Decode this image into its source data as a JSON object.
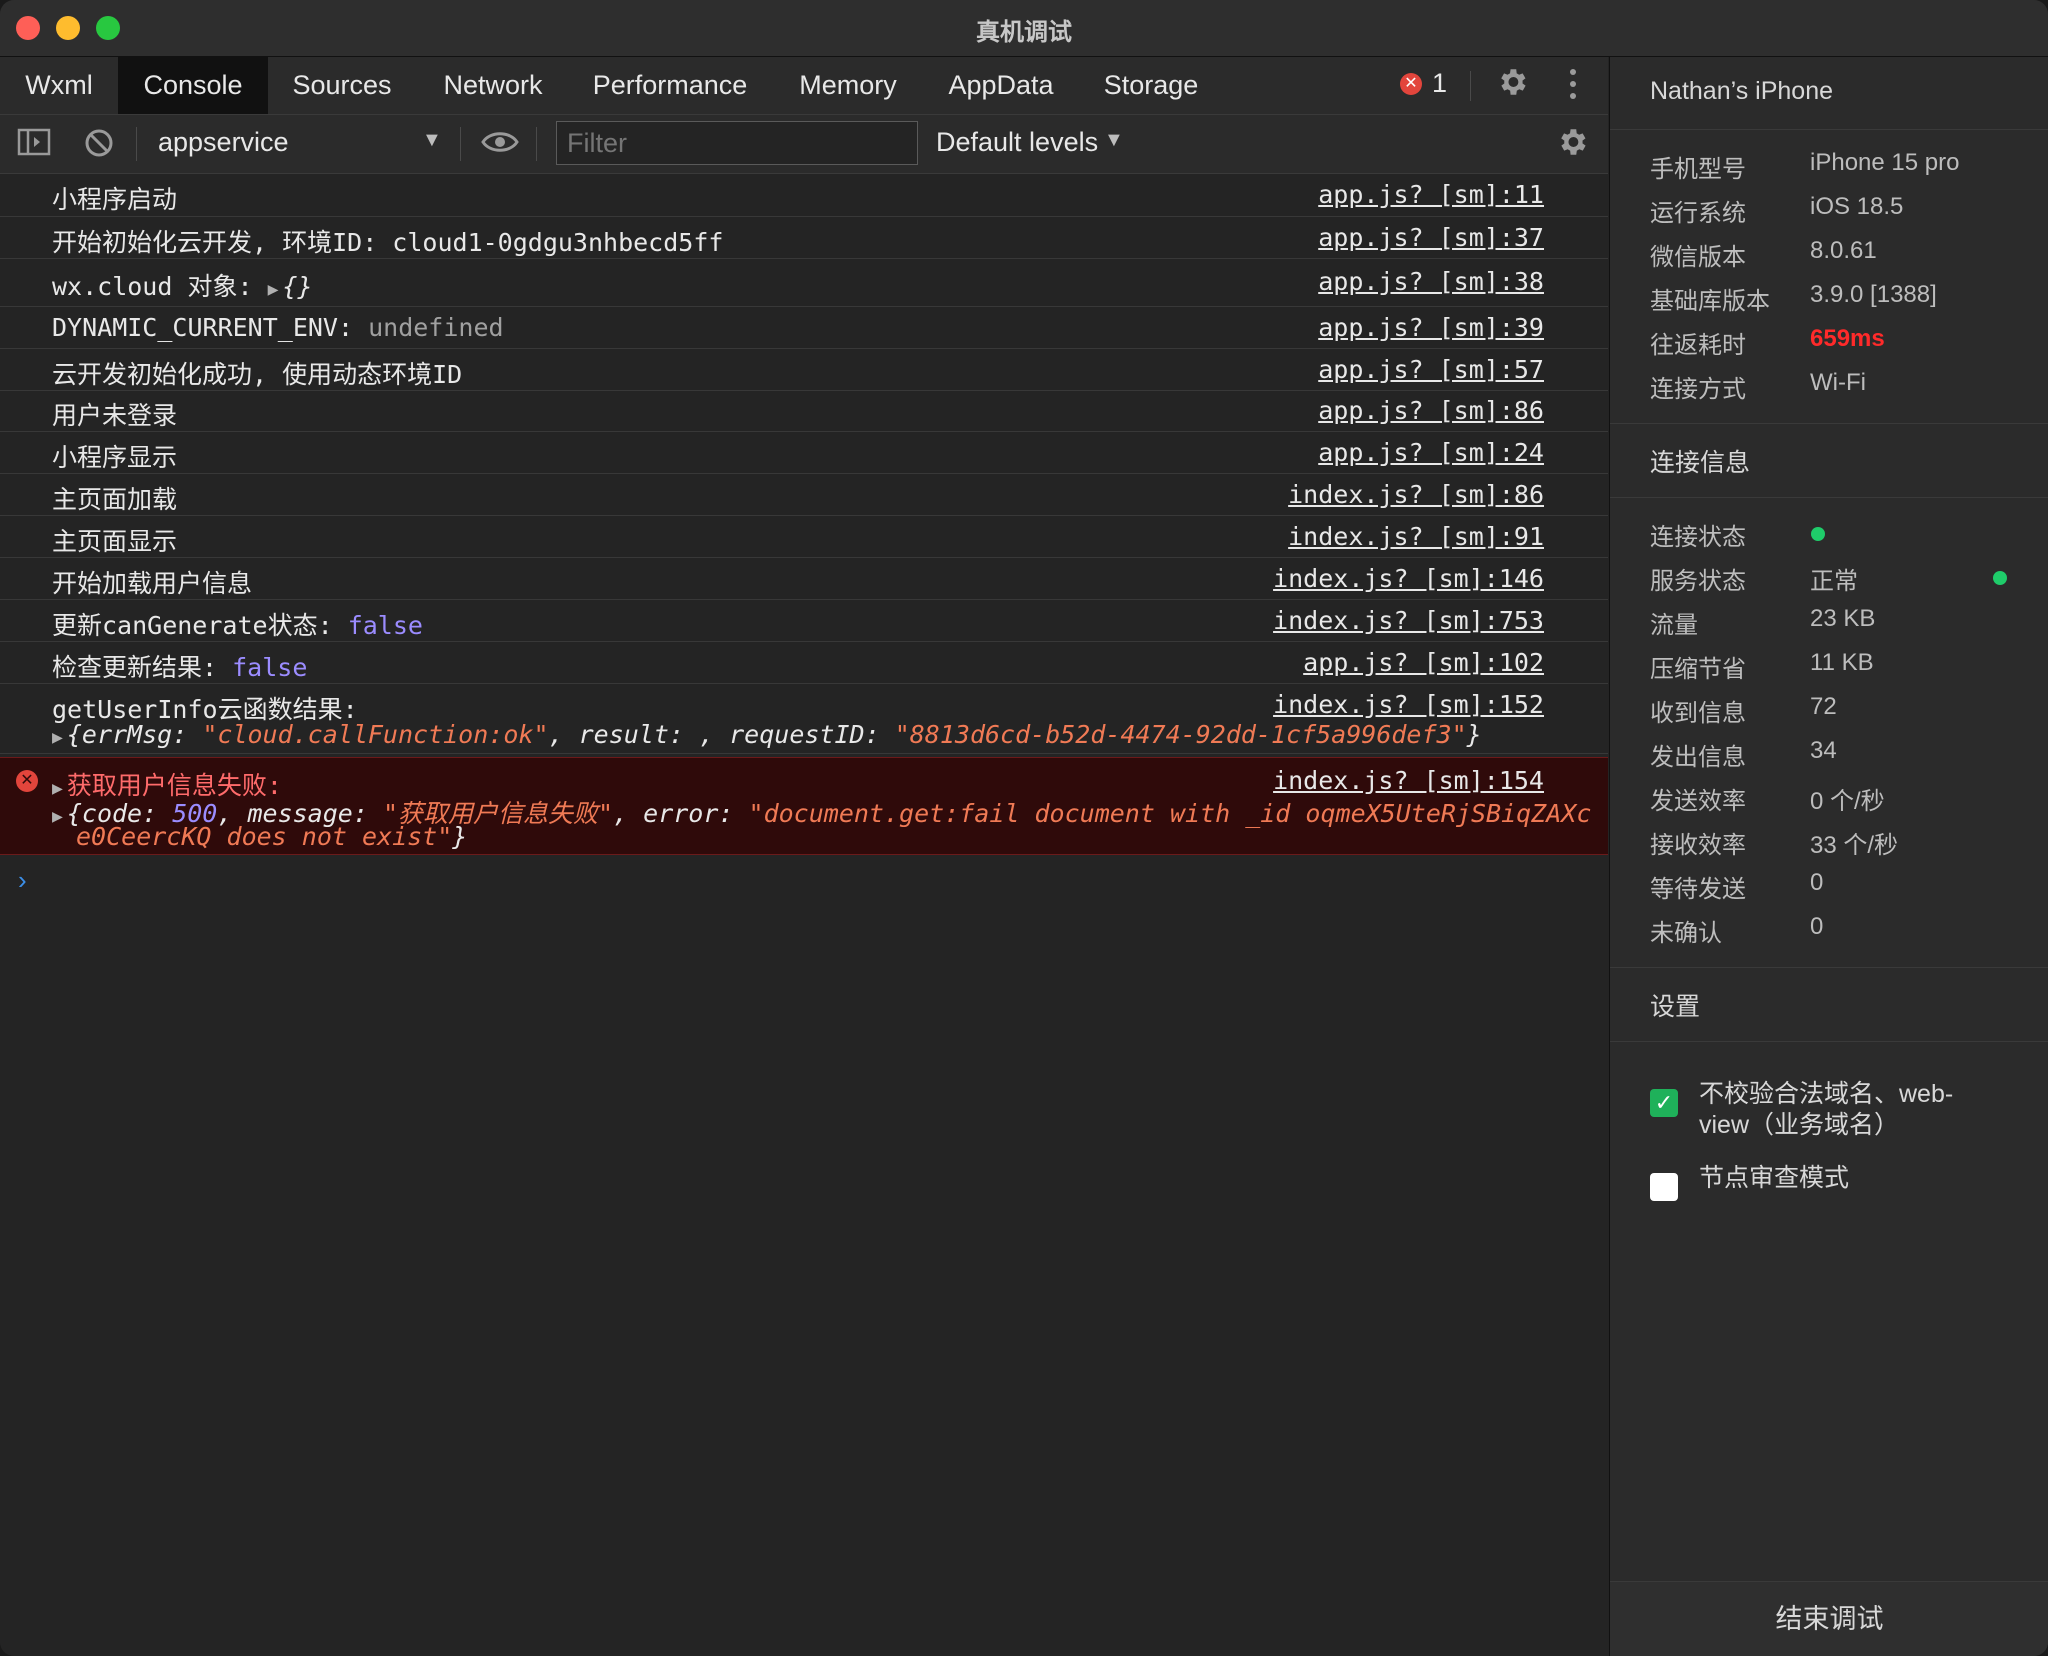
{
  "window": {
    "title": "真机调试"
  },
  "tabs": [
    "Wxml",
    "Console",
    "Sources",
    "Network",
    "Performance",
    "Memory",
    "AppData",
    "Storage"
  ],
  "active_tab": "Console",
  "error_count": "1",
  "toolbar": {
    "context": "appservice",
    "filter_placeholder": "Filter",
    "levels": "Default levels"
  },
  "logs": [
    {
      "text": "小程序启动",
      "source": "app.js? [sm]:11"
    },
    {
      "text": "开始初始化云开发, 环境ID: cloud1-0gdgu3nhbecd5ff",
      "source": "app.js? [sm]:37"
    },
    {
      "text": "wx.cloud 对象:",
      "obj": "{}",
      "source": "app.js? [sm]:38"
    },
    {
      "text": "DYNAMIC_CURRENT_ENV:",
      "value": "undefined",
      "source": "app.js? [sm]:39"
    },
    {
      "text": "云开发初始化成功, 使用动态环境ID",
      "source": "app.js? [sm]:57"
    },
    {
      "text": "用户未登录",
      "source": "app.js? [sm]:86"
    },
    {
      "text": "小程序显示",
      "source": "app.js? [sm]:24"
    },
    {
      "text": "主页面加载",
      "source": "index.js? [sm]:86"
    },
    {
      "text": "主页面显示",
      "source": "index.js? [sm]:91"
    },
    {
      "text": "开始加载用户信息",
      "source": "index.js? [sm]:146"
    },
    {
      "text": "更新canGenerate状态:",
      "value": "false",
      "source": "index.js? [sm]:753"
    },
    {
      "text": "检查更新结果:",
      "value": "false",
      "source": "app.js? [sm]:102"
    },
    {
      "text": "getUserInfo云函数结果:",
      "source": "index.js? [sm]:152",
      "obj_parts": {
        "open": "{errMsg: ",
        "errMsg": "\"cloud.callFunction:ok\"",
        "mid": ", result: , requestID: ",
        "requestID": "\"8813d6cd-b52d-4474-92dd-1cf5a996def3\"",
        "close": "}"
      }
    }
  ],
  "error_log": {
    "title": "获取用户信息失败:",
    "source": "index.js? [sm]:154",
    "p1": "{code: ",
    "code": "500",
    "p2": ", message: ",
    "message": "\"获取用户信息失败\"",
    "p3": ", error: ",
    "error_line1": "\"document.get:fail document with _id oqmeX5UteRjSBiqZAXc",
    "error_line2": "e0CeercKQ does not exist\"",
    "close": "}"
  },
  "prompt": "›",
  "device": {
    "name": "Nathan’s iPhone",
    "info": [
      {
        "key": "手机型号",
        "value": "iPhone 15 pro"
      },
      {
        "key": "运行系统",
        "value": "iOS 18.5"
      },
      {
        "key": "微信版本",
        "value": "8.0.61"
      },
      {
        "key": "基础库版本",
        "value": "3.9.0 [1388]"
      },
      {
        "key": "往返耗时",
        "value": "659ms"
      },
      {
        "key": "连接方式",
        "value": "Wi-Fi"
      }
    ],
    "connection_title": "连接信息",
    "connection": [
      {
        "key": "连接状态",
        "value": ""
      },
      {
        "key": "服务状态",
        "value": "正常"
      },
      {
        "key": "流量",
        "value": "23 KB"
      },
      {
        "key": "压缩节省",
        "value": "11 KB"
      },
      {
        "key": "收到信息",
        "value": "72"
      },
      {
        "key": "发出信息",
        "value": "34"
      },
      {
        "key": "发送效率",
        "value": "0 个/秒"
      },
      {
        "key": "接收效率",
        "value": "33 个/秒"
      },
      {
        "key": "等待发送",
        "value": "0"
      },
      {
        "key": "未确认",
        "value": "0"
      }
    ],
    "settings_title": "设置",
    "settings": [
      {
        "label": "不校验合法域名、web-view（业务域名）",
        "checked": true
      },
      {
        "label": "节点审查模式",
        "checked": false
      }
    ],
    "end_button": "结束调试"
  },
  "colors": {
    "accent_green": "#1fcc6a",
    "error_red": "#e2453c",
    "latency_red": "#ff2a2a",
    "keyword_purple": "#9b8cff",
    "string_orange": "#f07a55"
  },
  "icons": [
    "sidebar-toggle-icon",
    "clear-console-icon",
    "eye-icon",
    "gear-icon",
    "more-vertical-icon",
    "error-circle-icon",
    "checkmark-icon",
    "chevron-right-icon"
  ]
}
